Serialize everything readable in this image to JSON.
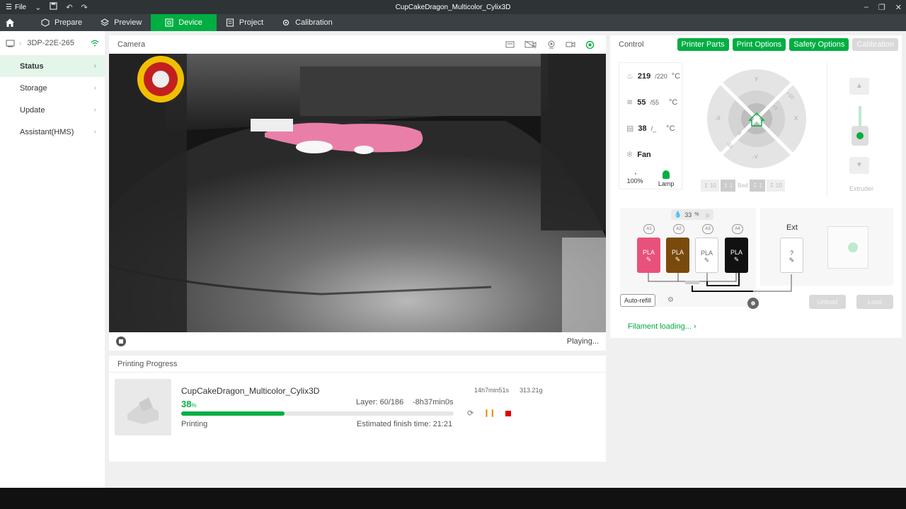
{
  "window": {
    "title": "CupCakeDragon_Multicolor_Cylix3D",
    "file_menu": "File"
  },
  "nav": {
    "tabs": [
      {
        "label": "Prepare"
      },
      {
        "label": "Preview"
      },
      {
        "label": "Device"
      },
      {
        "label": "Project"
      },
      {
        "label": "Calibration"
      }
    ],
    "active": "Device"
  },
  "sidebar": {
    "device_name": "3DP-22E-265",
    "items": [
      {
        "label": "Status"
      },
      {
        "label": "Storage"
      },
      {
        "label": "Update"
      },
      {
        "label": "Assistant(HMS)"
      }
    ]
  },
  "camera": {
    "title": "Camera",
    "status": "Playing..."
  },
  "progress": {
    "title": "Printing Progress",
    "job_name": "CupCakeDragon_Multicolor_Cylix3D",
    "percent": "38",
    "percent_unit": "%",
    "percent_value": 0.38,
    "layer": "Layer: 60/186",
    "remaining": "-8h37min0s",
    "status": "Printing",
    "finish": "Estimated finish time: 21:21",
    "total_time": "14h7min51s",
    "weight": "313.21g"
  },
  "control": {
    "title": "Control",
    "buttons": [
      {
        "label": "Printer Parts"
      },
      {
        "label": "Print Options"
      },
      {
        "label": "Safety Options"
      },
      {
        "label": "Calibration"
      }
    ],
    "nozzle": {
      "value": "219",
      "target": "/220",
      "unit": "°C"
    },
    "bed": {
      "value": "55",
      "target": "/55",
      "unit": "°C"
    },
    "chamber": {
      "value": "38",
      "target": "/_",
      "unit": "°C"
    },
    "fan_label": "Fan",
    "speed": "100%",
    "lamp_label": "Lamp",
    "jog": {
      "y_plus": "Y",
      "y_minus": "-Y",
      "x_plus": "X",
      "x_minus": "-X",
      "ten_plus": "+10",
      "one_plus": "+1",
      "one_minus": "-1",
      "ten_minus": "-10"
    },
    "bed_controls": {
      "up10": "10",
      "up1": "1",
      "label": "Bed",
      "down1": "1",
      "down10": "10"
    },
    "extruder_label": "Extruder",
    "ams": {
      "humidity": "33",
      "humidity_unit": "%",
      "slots": [
        {
          "label": "A1",
          "type": "PLA",
          "color": "#e8517b"
        },
        {
          "label": "A2",
          "type": "PLA",
          "color": "#7a4a0d"
        },
        {
          "label": "A3",
          "type": "PLA",
          "color": "#ffffff"
        },
        {
          "label": "A4",
          "type": "PLA",
          "color": "#111111"
        }
      ]
    },
    "ext": {
      "title": "Ext",
      "slot": "?"
    },
    "autorefill": "Auto-refill",
    "unload": "Unload",
    "load": "Load",
    "filament_loading": "Filament loading..."
  }
}
